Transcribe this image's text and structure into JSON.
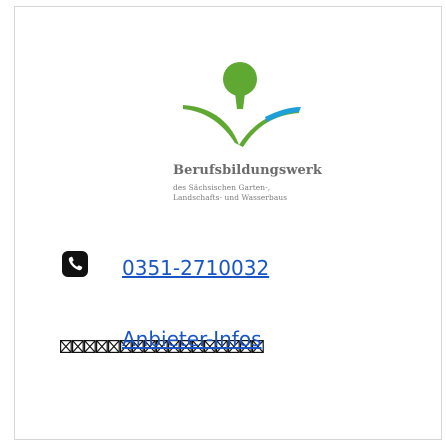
{
  "logo": {
    "title": "Berufsbildungswerk",
    "subtitle_line1": "des Sächsischen Garten-,",
    "subtitle_line2": "Landschafts- und Wasserbaus",
    "colors": {
      "leaf": "#5fa832",
      "water": "#1e9fd8",
      "text": "#6b6b6b"
    }
  },
  "contact": {
    "phone_icon": "phone-icon",
    "phone_number": "0351-2710032",
    "provider_info_link": "Anbieter-Infos",
    "link_color": "#1a55c8"
  }
}
